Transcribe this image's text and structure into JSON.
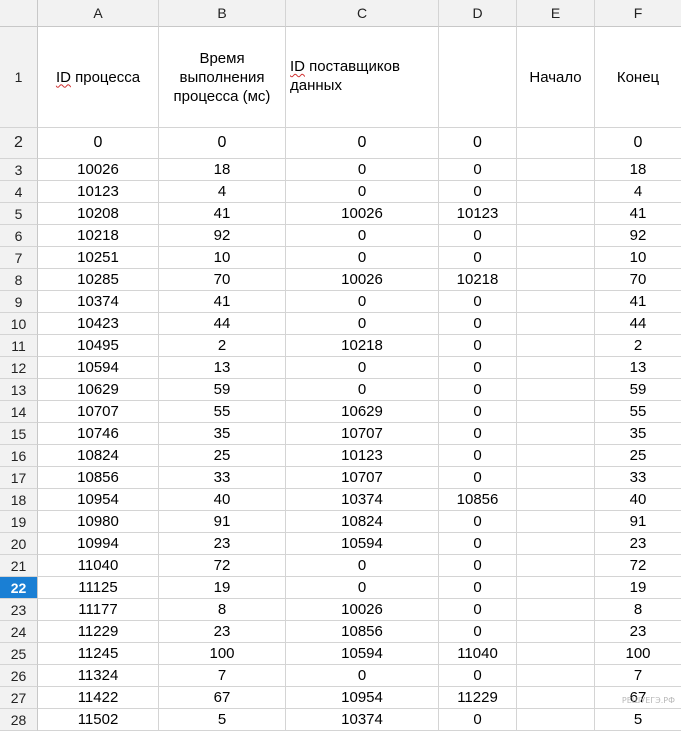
{
  "columns": [
    "A",
    "B",
    "C",
    "D",
    "E",
    "F"
  ],
  "header_row": {
    "row_number": "1",
    "id_label_prefix": "ID",
    "id_label_rest": " процесса",
    "time_label": "Время выполнения процесса (мс)",
    "suppliers_prefix": "ID",
    "suppliers_rest": " поставщиков данных",
    "d_label": "",
    "start_label": "Начало",
    "end_label": "Конец"
  },
  "rows": [
    {
      "n": "2",
      "a": "0",
      "b": "0",
      "c": "0",
      "d": "0",
      "e": "",
      "f": "0"
    },
    {
      "n": "3",
      "a": "10026",
      "b": "18",
      "c": "0",
      "d": "0",
      "e": "",
      "f": "18"
    },
    {
      "n": "4",
      "a": "10123",
      "b": "4",
      "c": "0",
      "d": "0",
      "e": "",
      "f": "4"
    },
    {
      "n": "5",
      "a": "10208",
      "b": "41",
      "c": "10026",
      "d": "10123",
      "e": "",
      "f": "41"
    },
    {
      "n": "6",
      "a": "10218",
      "b": "92",
      "c": "0",
      "d": "0",
      "e": "",
      "f": "92"
    },
    {
      "n": "7",
      "a": "10251",
      "b": "10",
      "c": "0",
      "d": "0",
      "e": "",
      "f": "10"
    },
    {
      "n": "8",
      "a": "10285",
      "b": "70",
      "c": "10026",
      "d": "10218",
      "e": "",
      "f": "70"
    },
    {
      "n": "9",
      "a": "10374",
      "b": "41",
      "c": "0",
      "d": "0",
      "e": "",
      "f": "41"
    },
    {
      "n": "10",
      "a": "10423",
      "b": "44",
      "c": "0",
      "d": "0",
      "e": "",
      "f": "44"
    },
    {
      "n": "11",
      "a": "10495",
      "b": "2",
      "c": "10218",
      "d": "0",
      "e": "",
      "f": "2"
    },
    {
      "n": "12",
      "a": "10594",
      "b": "13",
      "c": "0",
      "d": "0",
      "e": "",
      "f": "13"
    },
    {
      "n": "13",
      "a": "10629",
      "b": "59",
      "c": "0",
      "d": "0",
      "e": "",
      "f": "59"
    },
    {
      "n": "14",
      "a": "10707",
      "b": "55",
      "c": "10629",
      "d": "0",
      "e": "",
      "f": "55"
    },
    {
      "n": "15",
      "a": "10746",
      "b": "35",
      "c": "10707",
      "d": "0",
      "e": "",
      "f": "35"
    },
    {
      "n": "16",
      "a": "10824",
      "b": "25",
      "c": "10123",
      "d": "0",
      "e": "",
      "f": "25"
    },
    {
      "n": "17",
      "a": "10856",
      "b": "33",
      "c": "10707",
      "d": "0",
      "e": "",
      "f": "33"
    },
    {
      "n": "18",
      "a": "10954",
      "b": "40",
      "c": "10374",
      "d": "10856",
      "e": "",
      "f": "40"
    },
    {
      "n": "19",
      "a": "10980",
      "b": "91",
      "c": "10824",
      "d": "0",
      "e": "",
      "f": "91"
    },
    {
      "n": "20",
      "a": "10994",
      "b": "23",
      "c": "10594",
      "d": "0",
      "e": "",
      "f": "23"
    },
    {
      "n": "21",
      "a": "11040",
      "b": "72",
      "c": "0",
      "d": "0",
      "e": "",
      "f": "72"
    },
    {
      "n": "22",
      "a": "11125",
      "b": "19",
      "c": "0",
      "d": "0",
      "e": "",
      "f": "19"
    },
    {
      "n": "23",
      "a": "11177",
      "b": "8",
      "c": "10026",
      "d": "0",
      "e": "",
      "f": "8"
    },
    {
      "n": "24",
      "a": "11229",
      "b": "23",
      "c": "10856",
      "d": "0",
      "e": "",
      "f": "23"
    },
    {
      "n": "25",
      "a": "11245",
      "b": "100",
      "c": "10594",
      "d": "11040",
      "e": "",
      "f": "100"
    },
    {
      "n": "26",
      "a": "11324",
      "b": "7",
      "c": "0",
      "d": "0",
      "e": "",
      "f": "7"
    },
    {
      "n": "27",
      "a": "11422",
      "b": "67",
      "c": "10954",
      "d": "11229",
      "e": "",
      "f": "67"
    },
    {
      "n": "28",
      "a": "11502",
      "b": "5",
      "c": "10374",
      "d": "0",
      "e": "",
      "f": "5"
    }
  ],
  "active_row": "22",
  "watermark": "РЕШУЕГЭ.РФ",
  "colors": {
    "active_row_header": "#1a7fd4",
    "header_bg": "#f2f2f2",
    "gridline": "#d4d4d4"
  }
}
